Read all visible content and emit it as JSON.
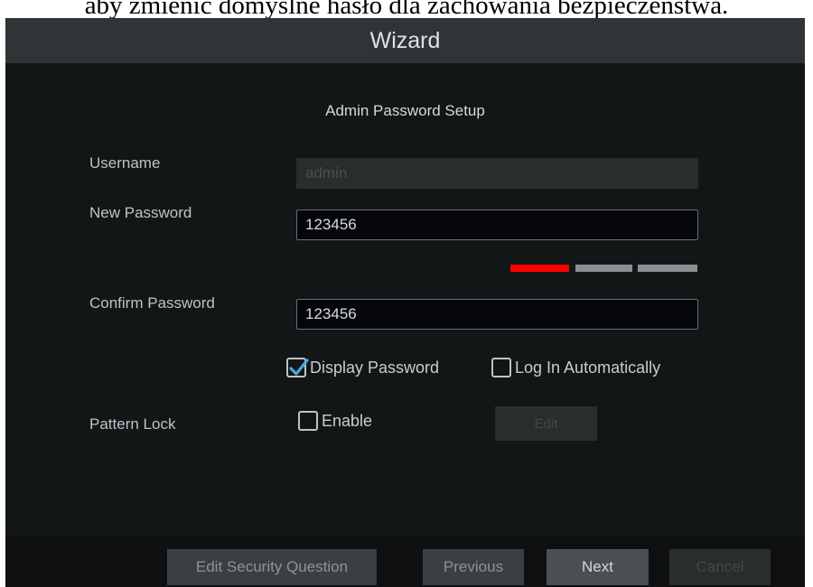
{
  "caption": "aby zmienić domyślne hasło dla zachowania bezpieczeństwa.",
  "window": {
    "title": "Wizard"
  },
  "section_title": "Admin Password Setup",
  "form": {
    "username": {
      "label": "Username",
      "value": "admin"
    },
    "new_password": {
      "label": "New Password",
      "value": "123456"
    },
    "confirm_password": {
      "label": "Confirm Password",
      "value": "123456"
    },
    "password_strength": {
      "level": 1,
      "of": 3,
      "colors": {
        "weak": "#ff0000",
        "inactive": "#8b8f91"
      }
    },
    "display_password": {
      "label": "Display Password",
      "checked": true
    },
    "log_in_automatically": {
      "label": "Log In Automatically",
      "checked": false
    },
    "pattern_lock": {
      "label": "Pattern Lock",
      "enable_label": "Enable",
      "enabled": false,
      "edit_label": "Edit"
    }
  },
  "footer": {
    "edit_security_question": "Edit Security Question",
    "previous": "Previous",
    "next": "Next",
    "cancel": "Cancel"
  },
  "colors": {
    "background": "#131617",
    "titlebar": "#2f3536",
    "checkmark": "#4aa8e0"
  },
  "icons": {
    "checked": "checkmark-icon"
  }
}
